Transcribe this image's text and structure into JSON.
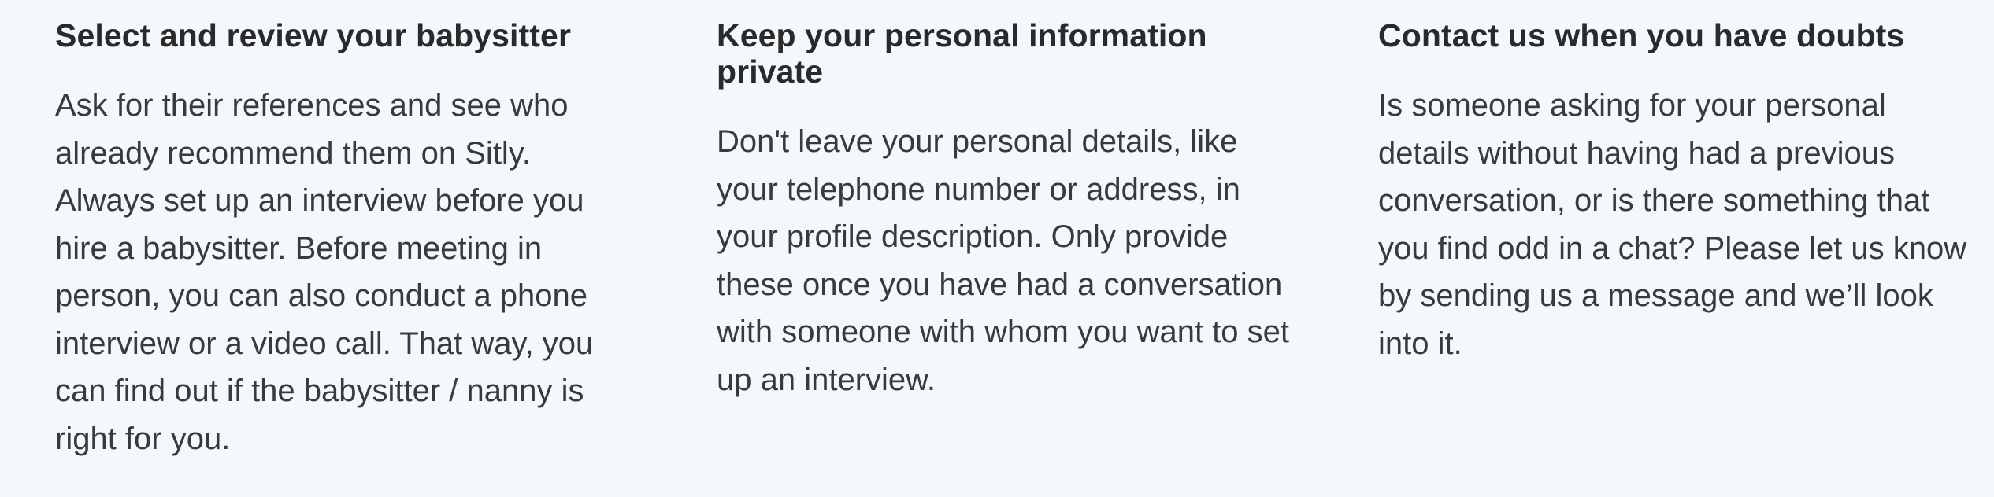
{
  "tips": [
    {
      "title": "Select and review your babysitter",
      "body": "Ask for their references and see who already recommend them on Sitly. Always set up an interview before you hire a babysitter. Before meeting in person, you can also conduct a phone interview or a video call. That way, you can find out if the babysitter / nanny is right for you."
    },
    {
      "title": "Keep your personal information private",
      "body": "Don't leave your personal details, like your telephone number or address, in your profile description. Only provide these once you have had a conversation with someone with whom you want to set up an interview."
    },
    {
      "title": "Contact us when you have doubts",
      "body": "Is someone asking for your personal details without having had a previous conversation, or is there something that you find odd in a chat? Please let us know by sending us a message and we’ll look into it."
    }
  ]
}
